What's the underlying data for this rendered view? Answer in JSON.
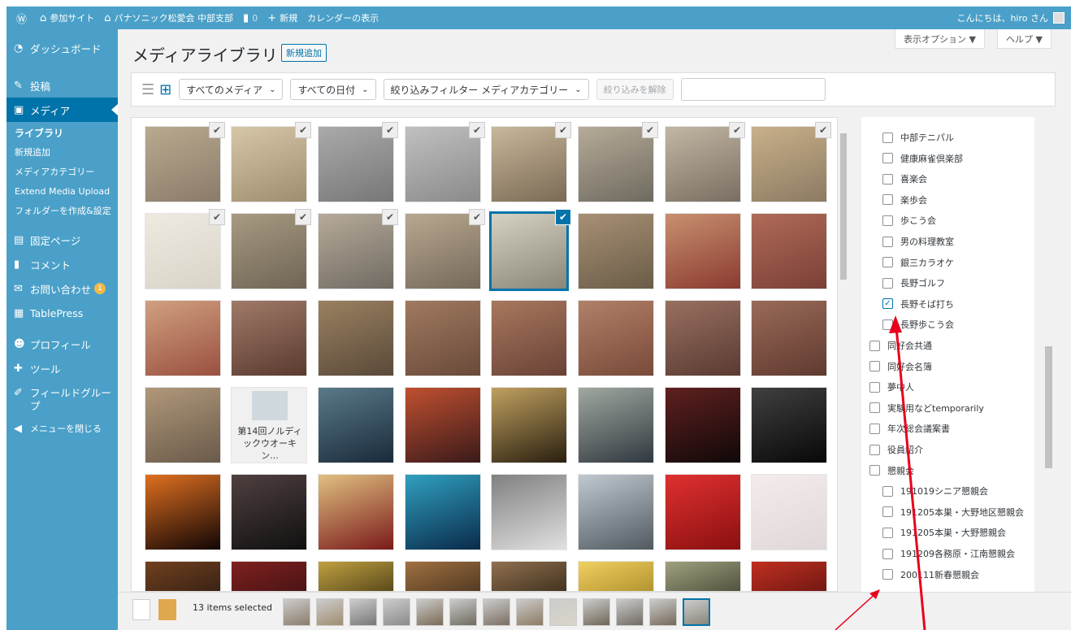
{
  "adminbar": {
    "items": [
      {
        "icon": "wordpress-icon",
        "label": ""
      },
      {
        "icon": "home-icon",
        "label": "参加サイト"
      },
      {
        "icon": "house-icon",
        "label": "パナソニック松愛会 中部支部"
      },
      {
        "icon": "comment-icon",
        "label": "0"
      },
      {
        "icon": "plus-icon",
        "label": "新規"
      },
      {
        "icon": "",
        "label": "カレンダーの表示"
      }
    ],
    "greeting": "こんにちは、hiro さん"
  },
  "sidebar": {
    "items": [
      {
        "icon": "dashboard-icon",
        "label": "ダッシュボード"
      },
      {
        "icon": "pin-icon",
        "label": "投稿"
      },
      {
        "icon": "media-icon",
        "label": "メディア",
        "current": true
      },
      {
        "icon": "page-icon",
        "label": "固定ページ"
      },
      {
        "icon": "comment-icon",
        "label": "コメント"
      },
      {
        "icon": "mail-icon",
        "label": "お問い合わせ",
        "badge": "1"
      },
      {
        "icon": "table-icon",
        "label": "TablePress"
      },
      {
        "icon": "user-icon",
        "label": "プロフィール"
      },
      {
        "icon": "wrench-icon",
        "label": "ツール"
      },
      {
        "icon": "brush-icon",
        "label": "フィールドグループ"
      },
      {
        "icon": "collapse-icon",
        "label": "メニューを閉じる"
      }
    ],
    "submenu": [
      "ライブラリ",
      "新規追加",
      "メディアカテゴリー",
      "Extend Media Upload",
      "フォルダーを作成&設定"
    ]
  },
  "header": {
    "title": "メディアライブラリ",
    "add_new": "新規追加",
    "screen_options": "表示オプション ▼",
    "help": "ヘルプ ▼"
  },
  "toolbar": {
    "filter_media": "すべてのメディア",
    "filter_date": "すべての日付",
    "filter_category": "絞り込みフィルター メディアカテゴリー",
    "clear_filter": "絞り込みを解除"
  },
  "grid": {
    "doc_tile_text": "第14回ノルディックウオーキン..."
  },
  "categories": [
    {
      "label": "中部テニパル",
      "level": 1,
      "checked": false
    },
    {
      "label": "健康麻雀倶楽部",
      "level": 1,
      "checked": false
    },
    {
      "label": "喜楽会",
      "level": 1,
      "checked": false
    },
    {
      "label": "楽歩会",
      "level": 1,
      "checked": false
    },
    {
      "label": "歩こう会",
      "level": 1,
      "checked": false
    },
    {
      "label": "男の料理教室",
      "level": 1,
      "checked": false
    },
    {
      "label": "銀三カラオケ",
      "level": 1,
      "checked": false
    },
    {
      "label": "長野ゴルフ",
      "level": 1,
      "checked": false
    },
    {
      "label": "長野そば打ち",
      "level": 1,
      "checked": true
    },
    {
      "label": "長野歩こう会",
      "level": 1,
      "checked": false
    },
    {
      "label": "同好会共通",
      "level": 0,
      "checked": false
    },
    {
      "label": "同好会名簿",
      "level": 0,
      "checked": false
    },
    {
      "label": "夢中人",
      "level": 0,
      "checked": false
    },
    {
      "label": "実験用などtemporarily",
      "level": 0,
      "checked": false
    },
    {
      "label": "年次総会議案書",
      "level": 0,
      "checked": false
    },
    {
      "label": "役員紹介",
      "level": 0,
      "checked": false
    },
    {
      "label": "懇親会",
      "level": 0,
      "checked": false
    },
    {
      "label": "191019シニア懇親会",
      "level": 1,
      "checked": false
    },
    {
      "label": "191205本巣・大野地区懇親会",
      "level": 1,
      "checked": false
    },
    {
      "label": "191205本巣・大野懇親会",
      "level": 1,
      "checked": false
    },
    {
      "label": "191209各務原・江南懇親会",
      "level": 1,
      "checked": false
    },
    {
      "label": "200111新春懇親会",
      "level": 1,
      "checked": false
    }
  ],
  "footer": {
    "selected_count": "13 items selected"
  },
  "colors": {
    "admin_blue": "#4aa0c8",
    "wp_blue": "#0073aa",
    "arrow_red": "#e8001c"
  }
}
